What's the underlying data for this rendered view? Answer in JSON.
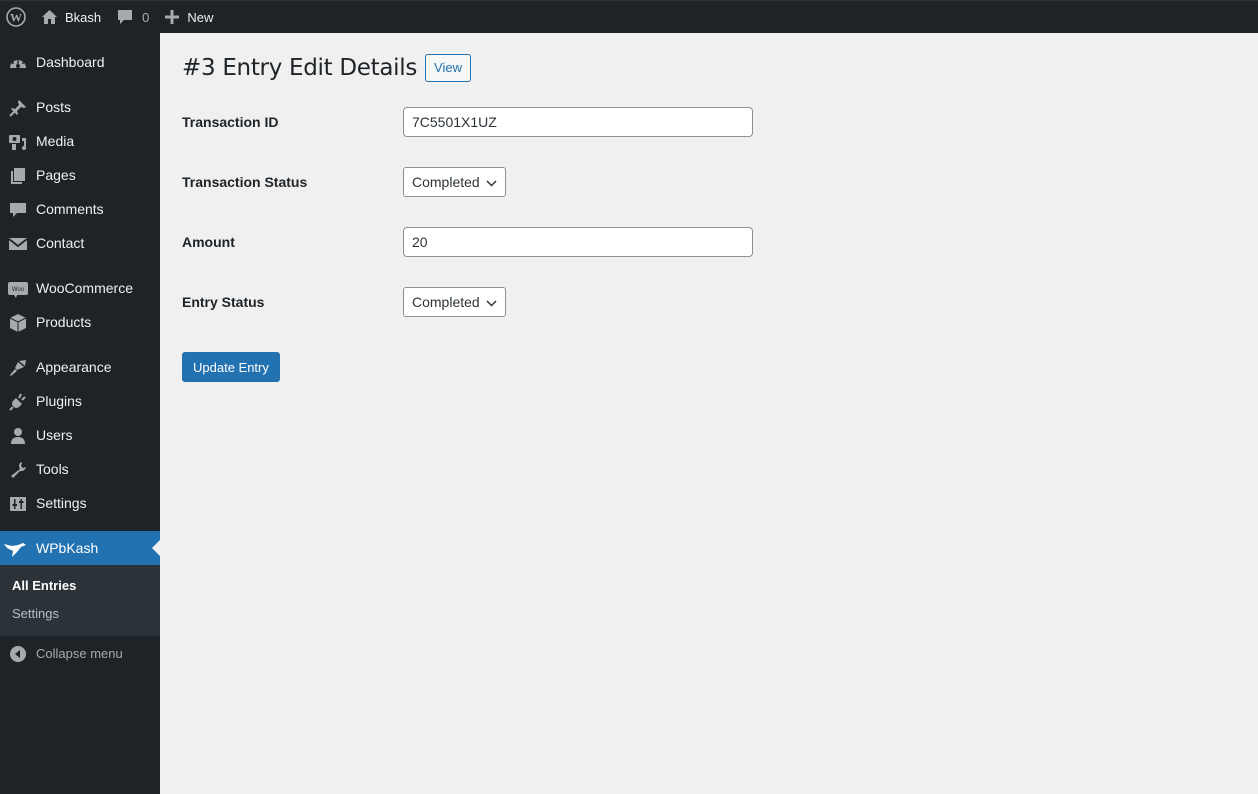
{
  "adminbar": {
    "site_name": "Bkash",
    "comments_count": "0",
    "new_label": "New"
  },
  "sidebar": {
    "items": [
      {
        "label": "Dashboard",
        "icon": "dashboard-icon"
      },
      {
        "label": "Posts",
        "icon": "pin-icon"
      },
      {
        "label": "Media",
        "icon": "media-icon"
      },
      {
        "label": "Pages",
        "icon": "pages-icon"
      },
      {
        "label": "Comments",
        "icon": "comment-icon"
      },
      {
        "label": "Contact",
        "icon": "envelope-icon"
      },
      {
        "label": "WooCommerce",
        "icon": "woo-icon"
      },
      {
        "label": "Products",
        "icon": "box-icon"
      },
      {
        "label": "Appearance",
        "icon": "brush-icon"
      },
      {
        "label": "Plugins",
        "icon": "plug-icon"
      },
      {
        "label": "Users",
        "icon": "user-icon"
      },
      {
        "label": "Tools",
        "icon": "wrench-icon"
      },
      {
        "label": "Settings",
        "icon": "sliders-icon"
      },
      {
        "label": "WPbKash",
        "icon": "bird-icon"
      }
    ],
    "submenu": [
      {
        "label": "All Entries"
      },
      {
        "label": "Settings"
      }
    ],
    "collapse_label": "Collapse menu"
  },
  "page": {
    "title": "#3 Entry Edit Details",
    "view_label": "View",
    "fields": {
      "transaction_id": {
        "label": "Transaction ID",
        "value": "7C5501X1UZ"
      },
      "transaction_status": {
        "label": "Transaction Status",
        "value": "Completed"
      },
      "amount": {
        "label": "Amount",
        "value": "20"
      },
      "entry_status": {
        "label": "Entry Status",
        "value": "Completed"
      }
    },
    "submit_label": "Update Entry"
  },
  "colors": {
    "admin_dark": "#1d2327",
    "accent": "#2271b1",
    "background": "#f0f0f1"
  }
}
